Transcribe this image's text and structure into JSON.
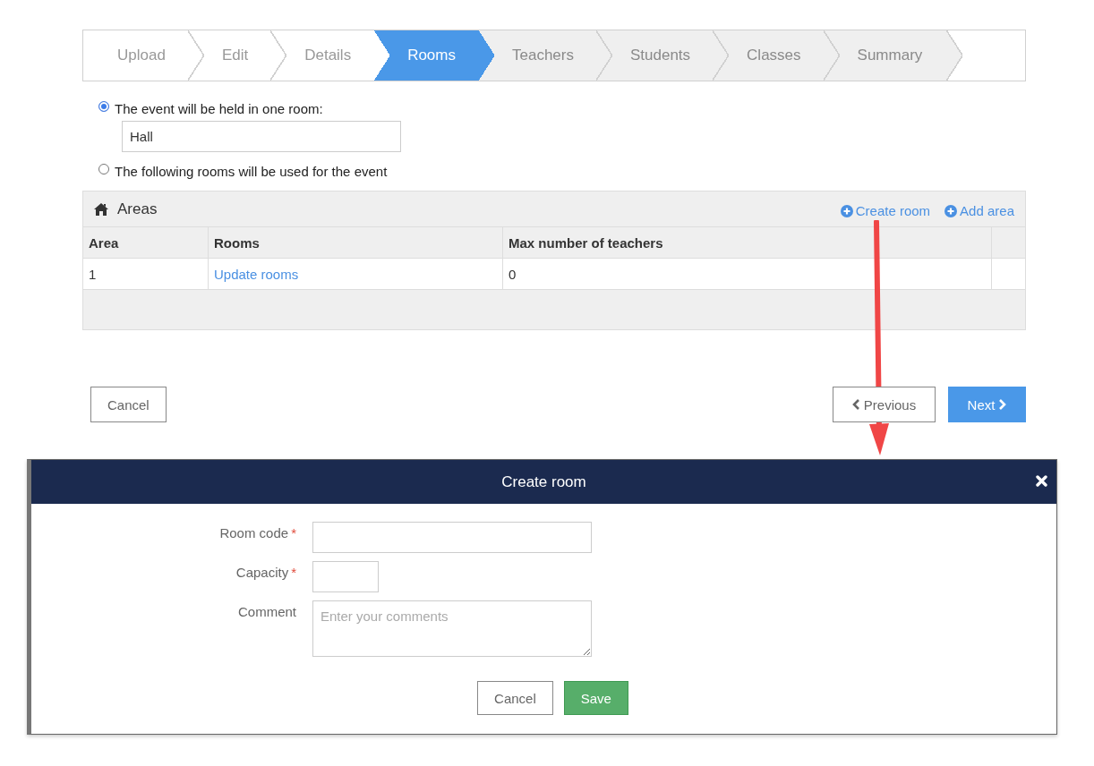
{
  "wizard": {
    "steps": [
      {
        "label": "Upload",
        "visited": true,
        "selected": false
      },
      {
        "label": "Edit",
        "visited": true,
        "selected": false
      },
      {
        "label": "Details",
        "visited": true,
        "selected": false
      },
      {
        "label": "Rooms",
        "selected": true
      },
      {
        "label": "Teachers",
        "visited": false,
        "selected": false
      },
      {
        "label": "Students",
        "visited": false,
        "selected": false
      },
      {
        "label": "Classes",
        "visited": false,
        "selected": false
      },
      {
        "label": "Summary",
        "visited": false,
        "selected": false
      }
    ]
  },
  "location": {
    "options": [
      {
        "label": "The event will be held in one room:",
        "selected": true,
        "value": "Hall"
      },
      {
        "label": "The following rooms will be used for the event",
        "selected": false
      }
    ]
  },
  "areas": {
    "title": "Areas",
    "actions": [
      {
        "label": "Create room"
      },
      {
        "label": "Add area"
      }
    ],
    "columns": [
      "Area",
      "Rooms",
      "Max number of teachers"
    ],
    "rows": [
      {
        "area": "1",
        "rooms": "Update rooms",
        "max_teachers": "0"
      }
    ]
  },
  "buttons": [
    {
      "label": "Cancel",
      "kind": "secondary"
    },
    {
      "label": "Previous",
      "kind": "back"
    },
    {
      "label": "Next",
      "kind": "forward"
    }
  ],
  "dialog": {
    "title": "Create room",
    "required_mark": "*",
    "fields": [
      {
        "label": "Room code",
        "required": true,
        "kind": "text"
      },
      {
        "label": "Capacity",
        "required": true,
        "kind": "short"
      },
      {
        "label": "Comment",
        "required": false,
        "kind": "textarea",
        "placeholder": "Enter your comments"
      }
    ],
    "buttons": [
      {
        "label": "Cancel",
        "kind": "secondary"
      },
      {
        "label": "Save",
        "kind": "primary"
      }
    ]
  }
}
